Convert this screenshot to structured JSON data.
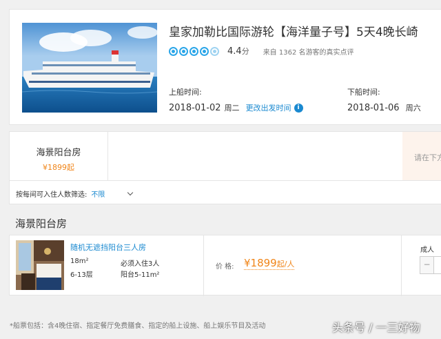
{
  "cruise": {
    "title": "皇家加勒比国际游轮【海洋量子号】5天4晚长崎",
    "rating": {
      "score": "4.4",
      "unit": "分",
      "stars_filled": 4,
      "stars_half": 1,
      "reviews_text": "来自 1362 名游客的真实点评"
    },
    "boarding": {
      "label": "上船时间:",
      "date": "2018-01-02",
      "weekday": "周二",
      "change_link": "更改出发时间"
    },
    "alighting": {
      "label": "下船时间:",
      "date": "2018-01-06",
      "weekday": "周六"
    }
  },
  "room_tabs": [
    {
      "name": "海景阳台房",
      "price": "¥1899起"
    }
  ],
  "notice_text": "请在下方",
  "filter": {
    "label": "按每间可入住人数筛选:",
    "value": "不限"
  },
  "section": {
    "title": "海景阳台房"
  },
  "room": {
    "name": "随机无遮挡阳台三人房",
    "area": "18m²",
    "floor": "6-13层",
    "occupancy": "必须入住3人",
    "balcony": "阳台5-11m²",
    "price_label": "价 格:",
    "price": "¥1899",
    "price_unit": "起/人",
    "adult_label": "成人",
    "minus_label": "−"
  },
  "footer_note": "*船票包括：含4晚住宿、指定餐厅免费膳食、指定的船上设施、船上娱乐节目及活动",
  "watermark": "头条号 / 一三好物",
  "colors": {
    "accent_blue": "#1a89d0",
    "price_orange": "#f08519",
    "rating_blue": "#2aa5e8"
  }
}
